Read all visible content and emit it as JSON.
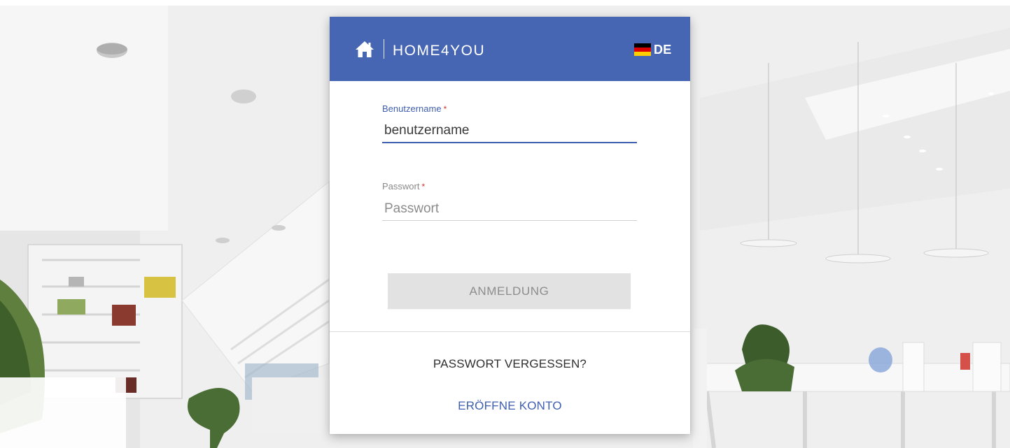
{
  "header": {
    "logo_text": "HOME4YOU",
    "language_code": "DE"
  },
  "login_form": {
    "username": {
      "label": "Benutzername",
      "required_mark": "*",
      "value": "benutzername"
    },
    "password": {
      "label": "Passwort",
      "required_mark": "*",
      "placeholder": "Passwort"
    },
    "submit_label": "ANMELDUNG",
    "forgot_password_label": "PASSWORT VERGESSEN?",
    "create_account_label": "ERÖFFNE KONTO"
  },
  "icons": {
    "home": "home-icon",
    "flag": "flag-de-icon"
  },
  "colors": {
    "brand_blue": "#4666b3",
    "accent_link": "#3f5fb0",
    "button_disabled": "#e2e2e2",
    "required_red": "#d0342c"
  }
}
